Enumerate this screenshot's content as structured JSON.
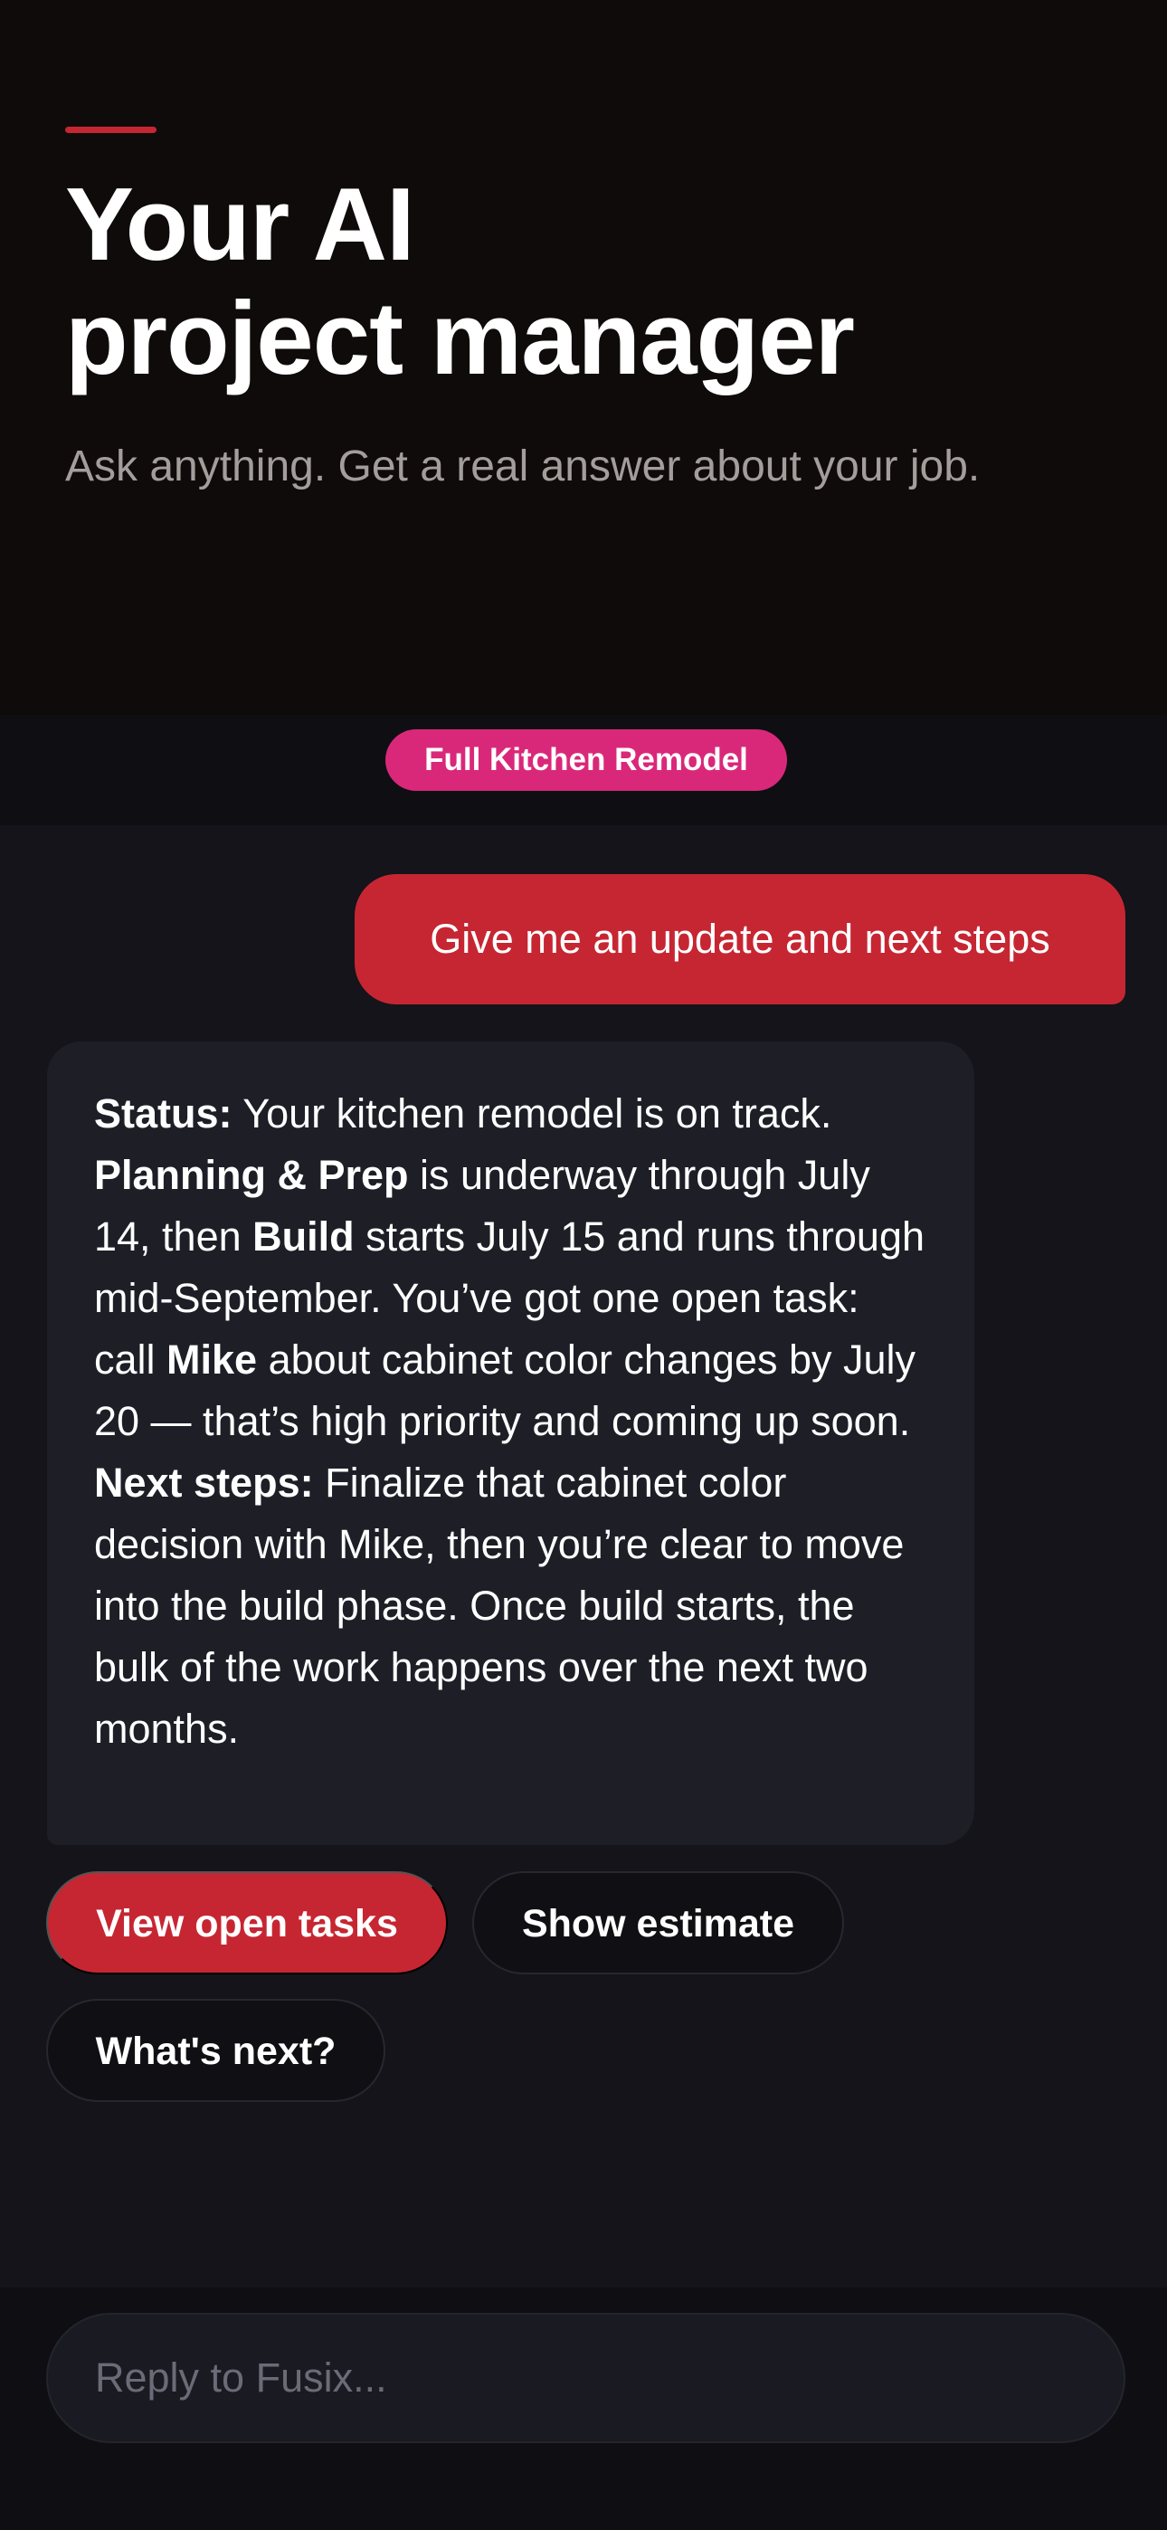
{
  "hero": {
    "title": "Your AI\nproject manager",
    "subtitle": "Ask anything. Get a real answer about your job.",
    "accent_color": "#c62632"
  },
  "project": {
    "label": "Full Kitchen Remodel",
    "color": "#d9287a"
  },
  "chat": {
    "user_message": "Give me an update and next steps",
    "assistant_message": {
      "status_label": "Status:",
      "status_text_1": " Your kitchen remodel is on track. ",
      "phase_planning": "Planning & Prep",
      "status_text_2": " is underway through July 14, then ",
      "phase_build": "Build",
      "status_text_3": " starts July 15 and runs through mid-September. You’ve got one open task: call ",
      "person": "Mike",
      "status_text_4": " about cabinet color changes by July 20 — that’s high priority and coming up soon.",
      "next_label": "Next steps:",
      "next_text": " Finalize that cabinet color decision with Mike, then you’re clear to move into the build phase. Once build starts, the bulk of the work happens over the next two months."
    }
  },
  "actions": {
    "view_tasks": "View open tasks",
    "show_estimate": "Show estimate",
    "whats_next": "What's next?"
  },
  "reply": {
    "placeholder": "Reply to Fusix...",
    "value": ""
  }
}
